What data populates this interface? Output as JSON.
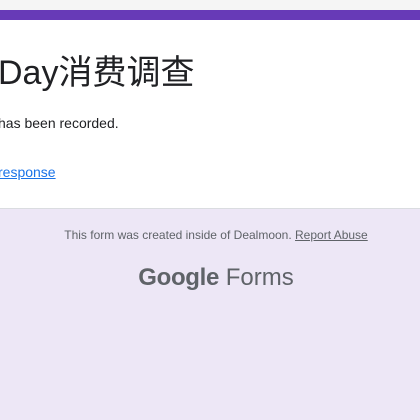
{
  "form": {
    "title": "Day消费调查",
    "confirmation_message": "has been recorded.",
    "edit_link_text": "response"
  },
  "footer": {
    "note": "This form was created inside of Dealmoon. ",
    "report_link": "Report Abuse",
    "brand_google": "Google",
    "brand_forms": " Forms"
  },
  "colors": {
    "accent": "#673ab7",
    "background": "#ede7f6",
    "link": "#1a73e8"
  }
}
